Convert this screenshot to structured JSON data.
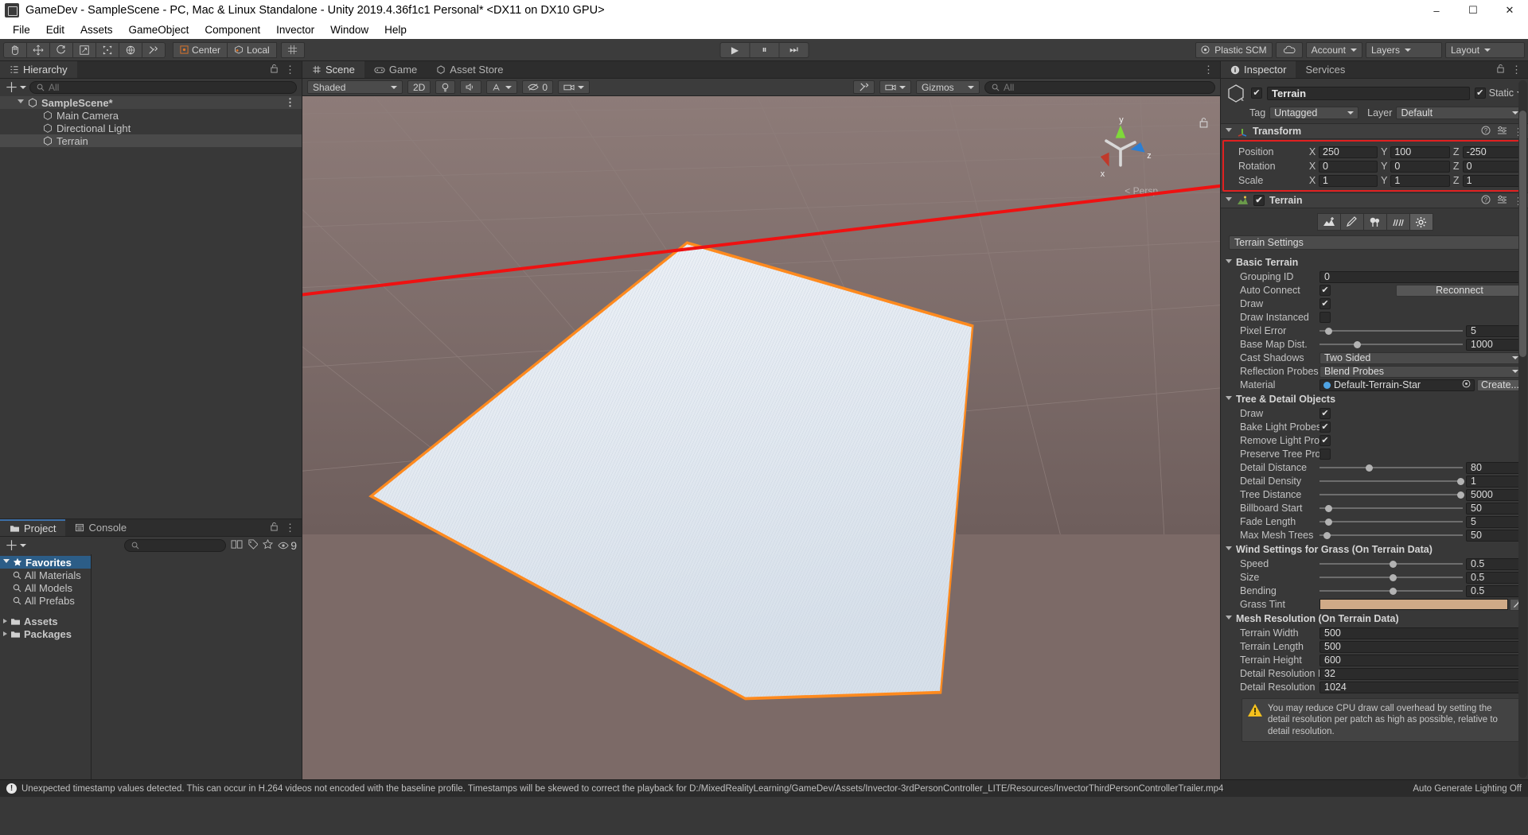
{
  "window": {
    "title": "GameDev - SampleScene - PC, Mac & Linux Standalone - Unity 2019.4.36f1c1 Personal* <DX11 on DX10 GPU>",
    "minimize": "–",
    "maximize": "☐",
    "close": "✕"
  },
  "menu": [
    "File",
    "Edit",
    "Assets",
    "GameObject",
    "Component",
    "Invector",
    "Window",
    "Help"
  ],
  "toolbar": {
    "transform_tools": [
      "hand-tool",
      "move-tool",
      "rotate-tool",
      "scale-tool",
      "rect-tool",
      "transform-tool",
      "custom-tool"
    ],
    "pivot_mode": "Center",
    "pivot_space": "Local",
    "play": "▶",
    "pause": "⏸",
    "step": "⏭",
    "collab": "Plastic SCM",
    "account": "Account",
    "layers": "Layers",
    "layout": "Layout"
  },
  "hierarchy": {
    "tab": "Hierarchy",
    "search_placeholder": "All",
    "items": [
      {
        "label": "SampleScene*",
        "depth": 0,
        "type": "scene"
      },
      {
        "label": "Main Camera",
        "depth": 1,
        "type": "object"
      },
      {
        "label": "Directional Light",
        "depth": 1,
        "type": "object"
      },
      {
        "label": "Terrain",
        "depth": 1,
        "type": "object",
        "selected": true
      }
    ]
  },
  "scene": {
    "tabs": [
      {
        "label": "Scene",
        "active": true
      },
      {
        "label": "Game",
        "active": false
      },
      {
        "label": "Asset Store",
        "active": false
      }
    ],
    "shading": "Shaded",
    "mode_2d": "2D",
    "audio_count": "0",
    "gizmos": "Gizmos",
    "search_placeholder": "All",
    "view_label": "Persp",
    "axis_x": "x",
    "axis_y": "y",
    "axis_z": "z"
  },
  "project": {
    "tabs": [
      {
        "label": "Project",
        "active": true
      },
      {
        "label": "Console",
        "active": false
      }
    ],
    "search_placeholder": "",
    "badge_count": "9",
    "tree": [
      {
        "label": "Favorites",
        "type": "favorites",
        "selected": true
      },
      {
        "label": "All Materials",
        "type": "search"
      },
      {
        "label": "All Models",
        "type": "search"
      },
      {
        "label": "All Prefabs",
        "type": "search"
      },
      {
        "label": "Assets",
        "type": "folder"
      },
      {
        "label": "Packages",
        "type": "folder"
      }
    ]
  },
  "inspector": {
    "tabs": [
      {
        "label": "Inspector",
        "active": true
      },
      {
        "label": "Services",
        "active": false
      }
    ],
    "object_name": "Terrain",
    "object_enabled": true,
    "static_label": "Static",
    "static_checked": true,
    "tag_label": "Tag",
    "tag_value": "Untagged",
    "layer_label": "Layer",
    "layer_value": "Default",
    "transform": {
      "title": "Transform",
      "rows": [
        {
          "label": "Position",
          "x": "250",
          "y": "100",
          "z": "-250"
        },
        {
          "label": "Rotation",
          "x": "0",
          "y": "0",
          "z": "0"
        },
        {
          "label": "Scale",
          "x": "1",
          "y": "1",
          "z": "1"
        }
      ],
      "highlight_color": "#e02020"
    },
    "terrain": {
      "title": "Terrain",
      "enabled": true,
      "tool_icons": [
        "raise-lower-terrain-icon",
        "paint-texture-icon",
        "paint-trees-icon",
        "paint-details-icon",
        "terrain-settings-icon"
      ],
      "selected_tool_index": 4,
      "settings_title": "Terrain Settings",
      "sections": [
        {
          "title": "Basic Terrain",
          "fields": [
            {
              "label": "Grouping ID",
              "kind": "text",
              "value": "0"
            },
            {
              "label": "Auto Connect",
              "kind": "check-button",
              "value": true,
              "button": "Reconnect"
            },
            {
              "label": "Draw",
              "kind": "check",
              "value": true
            },
            {
              "label": "Draw Instanced",
              "kind": "check",
              "value": false
            },
            {
              "label": "Pixel Error",
              "kind": "slider",
              "value": "5",
              "pos": 0.04
            },
            {
              "label": "Base Map Dist.",
              "kind": "slider",
              "value": "1000",
              "pos": 0.24
            },
            {
              "label": "Cast Shadows",
              "kind": "dropdown",
              "value": "Two Sided"
            },
            {
              "label": "Reflection Probes",
              "kind": "dropdown",
              "value": "Blend Probes"
            },
            {
              "label": "Material",
              "kind": "object",
              "value": "Default-Terrain-Star",
              "button": "Create..."
            }
          ]
        },
        {
          "title": "Tree & Detail Objects",
          "fields": [
            {
              "label": "Draw",
              "kind": "check",
              "value": true
            },
            {
              "label": "Bake Light Probes Fo",
              "kind": "check",
              "value": true
            },
            {
              "label": "Remove Light Probe I",
              "kind": "check",
              "value": true
            },
            {
              "label": "Preserve Tree Protot",
              "kind": "check",
              "value": false
            },
            {
              "label": "Detail Distance",
              "kind": "slider",
              "value": "80",
              "pos": 0.32
            },
            {
              "label": "Detail Density",
              "kind": "slider",
              "value": "1",
              "pos": 0.97
            },
            {
              "label": "Tree Distance",
              "kind": "slider",
              "value": "5000",
              "pos": 0.97
            },
            {
              "label": "Billboard Start",
              "kind": "slider",
              "value": "50",
              "pos": 0.04
            },
            {
              "label": "Fade Length",
              "kind": "slider",
              "value": "5",
              "pos": 0.04
            },
            {
              "label": "Max Mesh Trees",
              "kind": "slider",
              "value": "50",
              "pos": 0.03
            }
          ]
        },
        {
          "title": "Wind Settings for Grass (On Terrain Data)",
          "fields": [
            {
              "label": "Speed",
              "kind": "slider",
              "value": "0.5",
              "pos": 0.5
            },
            {
              "label": "Size",
              "kind": "slider",
              "value": "0.5",
              "pos": 0.5
            },
            {
              "label": "Bending",
              "kind": "slider",
              "value": "0.5",
              "pos": 0.5
            },
            {
              "label": "Grass Tint",
              "kind": "color",
              "value": "#d0aa87"
            }
          ]
        },
        {
          "title": "Mesh Resolution (On Terrain Data)",
          "fields": [
            {
              "label": "Terrain Width",
              "kind": "text",
              "value": "500"
            },
            {
              "label": "Terrain Length",
              "kind": "text",
              "value": "500"
            },
            {
              "label": "Terrain Height",
              "kind": "text",
              "value": "600"
            },
            {
              "label": "Detail Resolution Per",
              "kind": "text",
              "value": "32"
            },
            {
              "label": "Detail Resolution",
              "kind": "text",
              "value": "1024"
            }
          ]
        }
      ],
      "help_text": "You may reduce CPU draw call overhead by setting the detail resolution per patch as high as possible, relative to detail resolution."
    }
  },
  "status": {
    "message": "Unexpected timestamp values detected. This can occur in H.264 videos not encoded with the baseline profile. Timestamps will be skewed to correct the playback for D:/MixedRealityLearning/GameDev/Assets/Invector-3rdPersonController_LITE/Resources/InvectorThirdPersonControllerTrailer.mp4",
    "right": "Auto Generate Lighting Off"
  }
}
